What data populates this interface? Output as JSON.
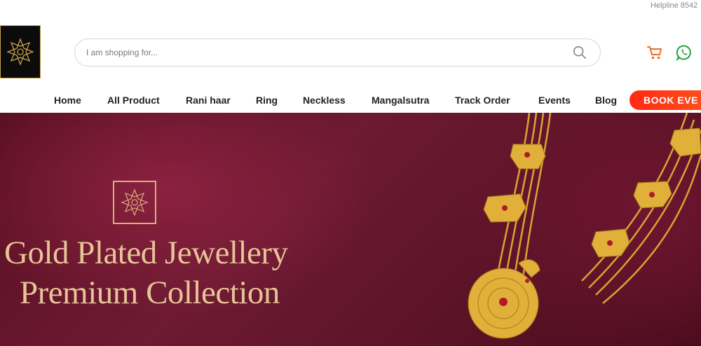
{
  "topbar": {
    "helpline": "Helpline 8542"
  },
  "search": {
    "placeholder": "I am shopping for..."
  },
  "icons": {
    "logo": "star-flower-logo-icon",
    "search": "search-icon",
    "cart": "cart-icon",
    "whatsapp": "whatsapp-icon"
  },
  "nav": {
    "items": [
      {
        "label": "Home"
      },
      {
        "label": "All Product"
      },
      {
        "label": "Rani haar"
      },
      {
        "label": "Ring"
      },
      {
        "label": "Neckless"
      },
      {
        "label": "Mangalsutra"
      },
      {
        "label": "Track Order"
      },
      {
        "label": "Events"
      },
      {
        "label": "Blog"
      }
    ],
    "book_button": "BOOK EVE"
  },
  "hero": {
    "line1": "Gold Plated Jewellery",
    "line2": "Premium Collection"
  },
  "colors": {
    "accent": "#ff3a14",
    "hero_bg": "#5a0f22",
    "gold_text": "#e6c497",
    "cart": "#f06a1c",
    "whatsapp": "#25a244"
  }
}
